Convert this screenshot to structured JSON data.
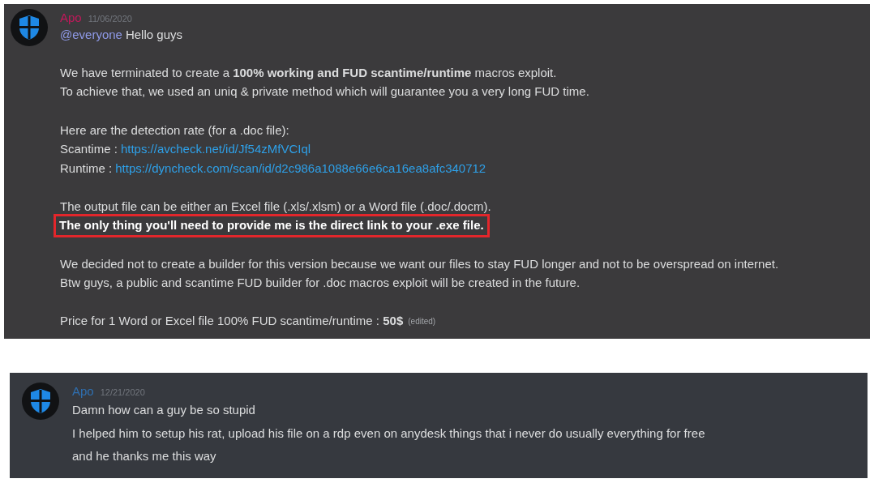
{
  "messages": [
    {
      "author": "Apo",
      "color": "#c2185b",
      "timestamp": "11/06/2020",
      "kind": "announcement",
      "lines": [
        {
          "kind": "mention",
          "mention": "@everyone",
          "text": "Hello guys"
        },
        {
          "kind": "blank"
        },
        {
          "kind": "text",
          "text": "We have terminated to create a **100% working and FUD scantime/runtime** macros exploit."
        },
        {
          "kind": "text",
          "text": "To achieve that, we used an uniq & private method which will guarantee you a very long FUD time."
        },
        {
          "kind": "blank"
        },
        {
          "kind": "text",
          "text": "Here are the detection rate (for a .doc file):"
        },
        {
          "kind": "link",
          "label": "Scantime :",
          "url": "https://avcheck.net/id/Jf54zMfVCIql"
        },
        {
          "kind": "link",
          "label": "Runtime :",
          "url": "https://dyncheck.com/scan/id/d2c986a1088e66e6ca16ea8afc340712"
        },
        {
          "kind": "blank"
        },
        {
          "kind": "text",
          "text": "The output file can be either an Excel file (.xls/.xlsm) or a Word file (.doc/.docm)."
        },
        {
          "kind": "boxed",
          "text": "The only thing you'll need to provide me is the direct link to your .exe file."
        },
        {
          "kind": "blank"
        },
        {
          "kind": "text",
          "text": "We decided not to create a builder for this version because we want our files to stay FUD longer and not to be overspread on internet."
        },
        {
          "kind": "text",
          "text": "Btw guys, a public and scantime FUD builder for .doc macros exploit will be created in the future."
        },
        {
          "kind": "blank"
        },
        {
          "kind": "text",
          "text": "Price for 1 Word or Excel file 100% FUD scantime/runtime : **50$**",
          "edited": "(edited)"
        }
      ]
    },
    {
      "author": "Apo",
      "color": "#2f6fb0",
      "timestamp": "12/21/2020",
      "kind": "reply",
      "lines": [
        {
          "kind": "text",
          "text": "Damn how can a guy be so stupid"
        },
        {
          "kind": "text",
          "text": "I helped him to setup his rat, upload his file on a rdp even on anydesk things that i never do usually everything for free"
        },
        {
          "kind": "text",
          "text": "and he thanks me this way"
        }
      ]
    }
  ]
}
